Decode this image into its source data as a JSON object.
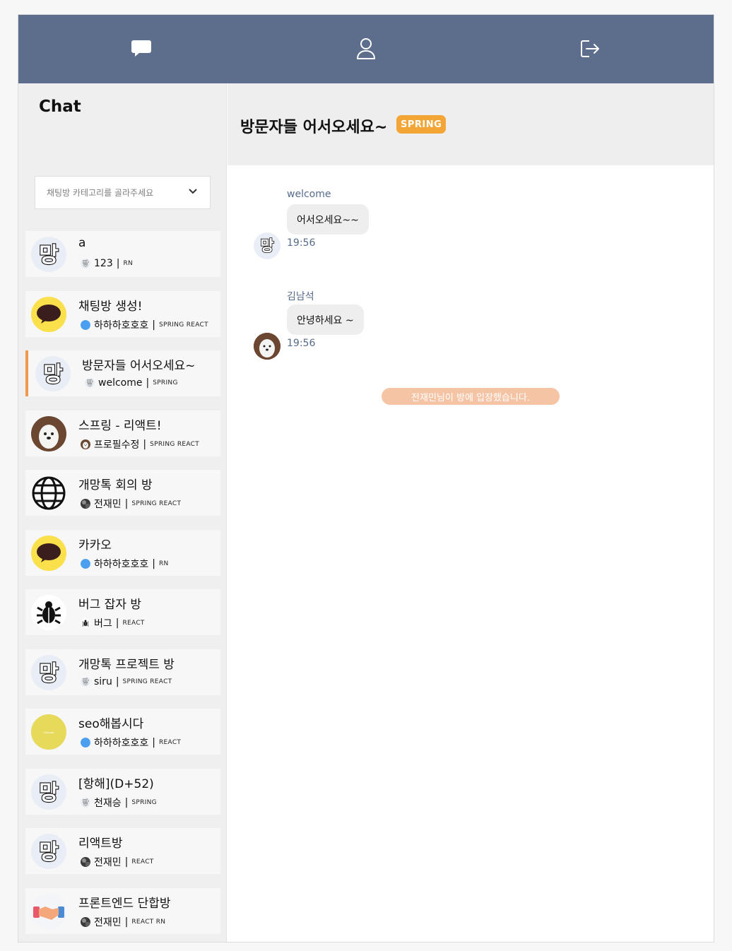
{
  "nav": {
    "chat_icon": "chat-bubble-icon",
    "profile_icon": "user-icon",
    "logout_icon": "logout-icon"
  },
  "sidebar": {
    "title": "Chat",
    "category_placeholder": "채팅방 카테고리를 골라주세요"
  },
  "rooms": [
    {
      "name": "a",
      "owner": "123",
      "tags": "RN",
      "avatar": "mang-logo",
      "owner_avatar": "mang-logo",
      "active": false
    },
    {
      "name": "채팅방 생성!",
      "owner": "하하하호호호",
      "tags": "SPRING REACT",
      "avatar": "kakao-bubble",
      "owner_avatar": "blue-dot",
      "active": false
    },
    {
      "name": "방문자들 어서오세요~",
      "owner": "welcome",
      "tags": "SPRING",
      "avatar": "mang-logo",
      "owner_avatar": "mang-logo",
      "active": true
    },
    {
      "name": "스프링 - 리액트!",
      "owner": "프로필수정",
      "tags": "SPRING REACT",
      "avatar": "dog-photo",
      "owner_avatar": "dog-photo",
      "active": false
    },
    {
      "name": "개망톡 회의 방",
      "owner": "전재민",
      "tags": "SPRING REACT",
      "avatar": "globe",
      "owner_avatar": "photo",
      "active": false
    },
    {
      "name": "카카오",
      "owner": "하하하호호호",
      "tags": "RN",
      "avatar": "kakao-bubble",
      "owner_avatar": "blue-dot",
      "active": false
    },
    {
      "name": "버그 잡자 방",
      "owner": "버그",
      "tags": "REACT",
      "avatar": "bug",
      "owner_avatar": "bug",
      "active": false
    },
    {
      "name": "개망톡 프로젝트 방",
      "owner": "siru",
      "tags": "SPRING REACT",
      "avatar": "mang-logo",
      "owner_avatar": "mang-logo",
      "active": false
    },
    {
      "name": "seo해봅시다",
      "owner": "하하하호호호",
      "tags": "REACT",
      "avatar": "yellow-circle",
      "owner_avatar": "blue-dot",
      "active": false
    },
    {
      "name": "[항해](D+52)",
      "owner": "천재승",
      "tags": "SPRING",
      "avatar": "mang-logo",
      "owner_avatar": "mang-logo",
      "active": false
    },
    {
      "name": "리액트방",
      "owner": "전재민",
      "tags": "REACT",
      "avatar": "mang-logo",
      "owner_avatar": "photo",
      "active": false
    },
    {
      "name": "프론트엔드 단합방",
      "owner": "전재민",
      "tags": "REACT RN",
      "avatar": "handshake",
      "owner_avatar": "photo",
      "active": false
    }
  ],
  "chat": {
    "title": "방문자들 어서오세요~",
    "badge": "SPRING",
    "messages": [
      {
        "author": "welcome",
        "text": "어서오세요~~",
        "time": "19:56",
        "avatar": "mang-logo"
      },
      {
        "author": "김남석",
        "text": "안녕하세요 ~",
        "time": "19:56",
        "avatar": "dog-photo"
      }
    ],
    "system_message": "전재민님이 방에 입장했습니다."
  },
  "colors": {
    "topbar": "#5d6d8c",
    "accent": "#f0994e",
    "badge": "#f3a536",
    "system": "#f5c4a5",
    "meta_text": "#556b8a"
  }
}
